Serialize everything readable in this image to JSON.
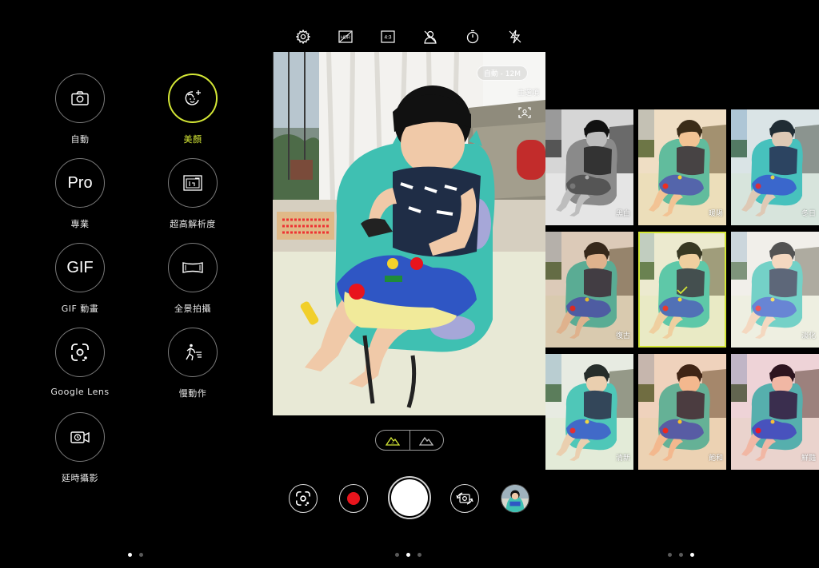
{
  "modes": [
    {
      "id": "auto",
      "label": "自動",
      "icon": "camera-icon",
      "active": false
    },
    {
      "id": "beauty",
      "label": "美顏",
      "icon": "beauty-face-icon",
      "active": true
    },
    {
      "id": "pro",
      "label": "專業",
      "icon_text": "Pro",
      "active": false
    },
    {
      "id": "hires",
      "label": "超高解析度",
      "icon": "hi-res-icon",
      "active": false
    },
    {
      "id": "gif",
      "label": "GIF 動畫",
      "icon_text": "GIF",
      "active": false
    },
    {
      "id": "panorama",
      "label": "全景拍攝",
      "icon": "panorama-icon",
      "active": false
    },
    {
      "id": "lens",
      "label": "Google Lens",
      "icon": "google-lens-icon",
      "active": false
    },
    {
      "id": "slowmo",
      "label": "慢動作",
      "icon": "slow-motion-icon",
      "active": false
    },
    {
      "id": "timelapse",
      "label": "延時攝影",
      "icon": "time-lapse-icon",
      "active": false
    }
  ],
  "camera": {
    "topbar_icons": [
      "settings-icon",
      "hdr-off-icon",
      "aspect-ratio-icon",
      "beauty-off-icon",
      "timer-icon",
      "flash-off-icon"
    ],
    "aspect_ratio": "4:3",
    "resolution_badge": "自動 - 12M",
    "scene_label": "主選項",
    "scene_toggle": [
      "scene-ai-icon",
      "scene-mountain-icon"
    ]
  },
  "filters": [
    {
      "name": "黑白"
    },
    {
      "name": "暖陽"
    },
    {
      "name": "冬日"
    },
    {
      "name": "復古"
    },
    {
      "name": "",
      "selected": true
    },
    {
      "name": "淡化"
    },
    {
      "name": "清新"
    },
    {
      "name": "飽和"
    },
    {
      "name": "鮮豔"
    }
  ],
  "colors": {
    "accent": "#d4e736",
    "record": "#e8141c",
    "background": "#000000"
  }
}
